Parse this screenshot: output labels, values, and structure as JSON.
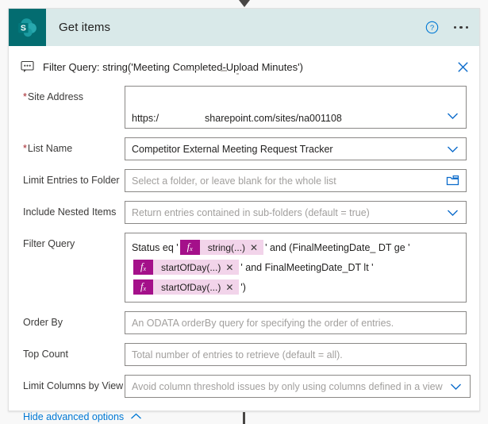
{
  "connector": {
    "top_arrow_icon": "arrow-down-icon",
    "bottom_line_icon": "connector-line"
  },
  "header": {
    "app_icon": "sharepoint-icon",
    "title": "Get items",
    "help_icon": "help-circle-icon",
    "menu_icon": "ellipsis-icon",
    "background_color": "#d9e9e9",
    "icon_tile_color": "#036c70"
  },
  "banner": {
    "icon": "comment-icon",
    "text": "Filter Query: string('Meeting Completed-Upload Minutes')",
    "close_icon": "close-icon",
    "close_color": "#0078d4"
  },
  "fields": {
    "site_address": {
      "label": "Site Address",
      "required": true,
      "value_prefix": "https:/",
      "value_suffix": "sharepoint.com/sites/na001108",
      "chevron_icon": "chevron-down-icon"
    },
    "list_name": {
      "label": "List Name",
      "required": true,
      "value": "Competitor External Meeting Request Tracker",
      "chevron_icon": "chevron-down-icon"
    },
    "limit_entries_to_folder": {
      "label": "Limit Entries to Folder",
      "required": false,
      "placeholder": "Select a folder, or leave blank for the whole list",
      "folder_icon": "folder-icon"
    },
    "include_nested_items": {
      "label": "Include Nested Items",
      "required": false,
      "placeholder": "Return entries contained in sub-folders (default = true)",
      "chevron_icon": "chevron-down-icon"
    },
    "filter_query": {
      "label": "Filter Query",
      "required": false,
      "lines": [
        {
          "before": "Status eq '",
          "token": {
            "fx": "fx",
            "label": "string(...)",
            "remove_icon": "close-icon"
          },
          "after": "' and (FinalMeetingDate_ DT ge '"
        },
        {
          "before": "",
          "token": {
            "fx": "fx",
            "label": "startOfDay(...)",
            "remove_icon": "close-icon"
          },
          "after": "' and FinalMeetingDate_DT lt '"
        },
        {
          "before": "",
          "token": {
            "fx": "fx",
            "label": "startOfDay(...)",
            "remove_icon": "close-icon"
          },
          "after": "')"
        }
      ],
      "token_fx_color": "#a4108a",
      "token_body_color": "#f2d4ea"
    },
    "order_by": {
      "label": "Order By",
      "required": false,
      "placeholder": "An ODATA orderBy query for specifying the order of entries."
    },
    "top_count": {
      "label": "Top Count",
      "required": false,
      "placeholder": "Total number of entries to retrieve (default = all)."
    },
    "limit_columns_by_view": {
      "label": "Limit Columns by View",
      "required": false,
      "placeholder": "Avoid column threshold issues by only using columns defined in a view",
      "chevron_icon": "chevron-down-icon"
    }
  },
  "footer": {
    "advanced_options_label": "Hide advanced options",
    "chevron_icon": "chevron-up-icon",
    "link_color": "#0078d4"
  }
}
